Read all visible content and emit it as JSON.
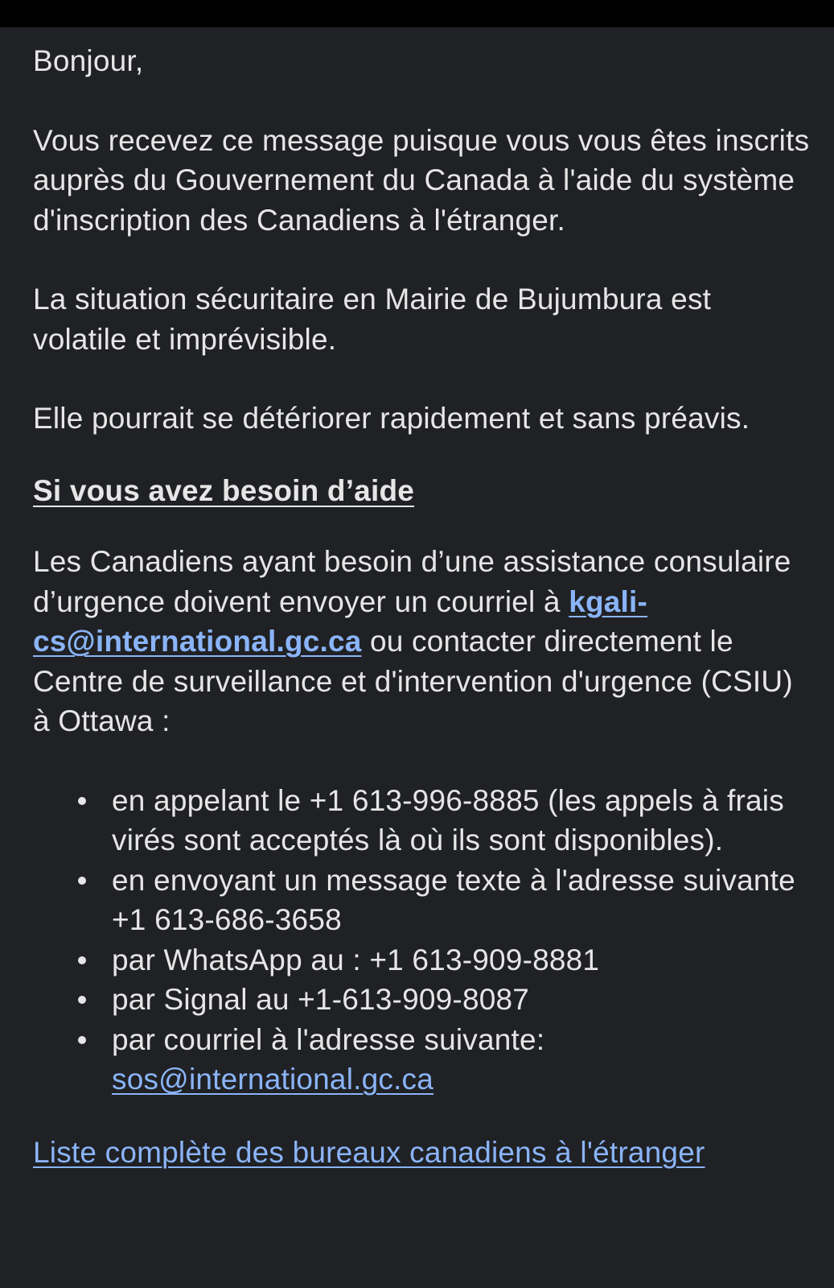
{
  "greeting": "Bonjour,",
  "intro": "Vous recevez ce message puisque vous vous êtes inscrits auprès du Gouvernement du Canada à l'aide du système d'inscription des Canadiens à l'étranger.",
  "situation": "La situation sécuritaire en Mairie de Bujumbura est volatile et imprévisible.",
  "deterioration": "Elle pourrait se détériorer rapidement et sans préavis.",
  "help_heading": "Si vous avez besoin d’aide",
  "assistance": {
    "before_email": "Les Canadiens ayant besoin d’une assistance consulaire d’urgence doivent envoyer un courriel à ",
    "email": "kgali-cs@international.gc.ca",
    "after_email": " ou contacter directement le Centre de surveillance et d'intervention d'urgence (CSIU) à Ottawa :"
  },
  "contacts": [
    "en appelant le +1 613-996-8885 (les appels à frais virés sont acceptés là où ils sont disponibles).",
    "en envoyant un message texte à l'adresse suivante +1 613-686-3658",
    "par WhatsApp au : +1 613-909-8881",
    "par Signal au +1-613-909-8087"
  ],
  "email_contact": {
    "prefix": "par courriel à l'adresse suivante: ",
    "email": "sos@international.gc.ca"
  },
  "offices_link": "Liste complète des bureaux canadiens à l'étranger",
  "colors": {
    "background": "#202124",
    "text": "#e6e6e6",
    "link": "#8ab4f8"
  }
}
